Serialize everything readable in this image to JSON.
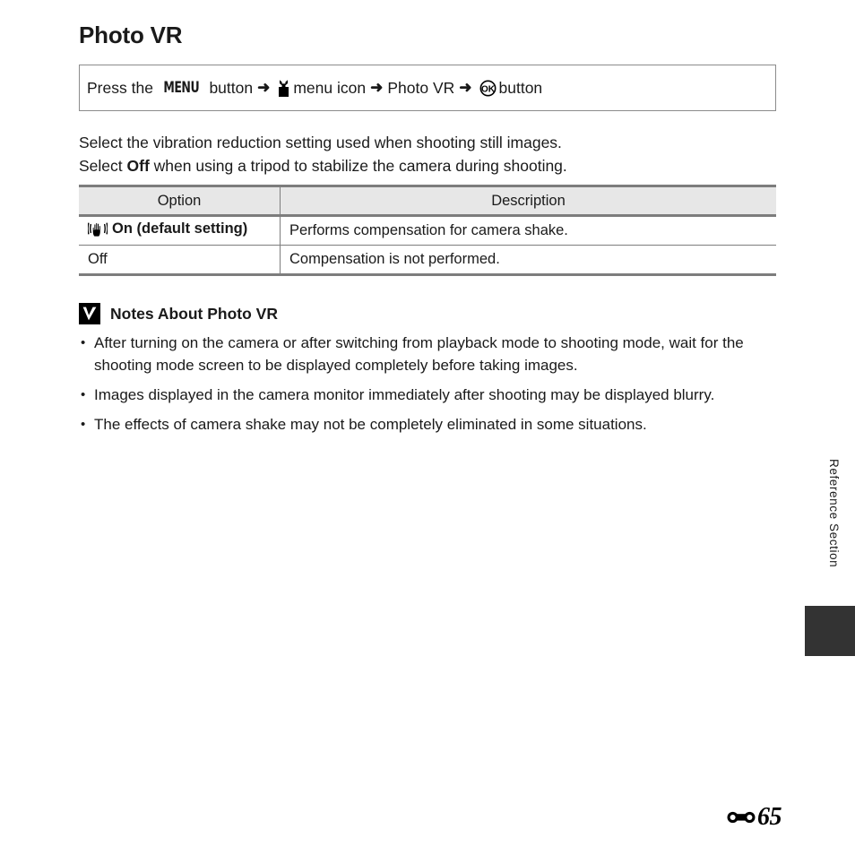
{
  "page": {
    "title": "Photo VR"
  },
  "menu_path": {
    "prefix": "Press the",
    "menu_button_glyph": "MENU",
    "after_menu_button": "button",
    "arrow": "➜",
    "setup_icon_name": "wrench-icon",
    "setup_label": "menu icon",
    "item_label": "Photo VR",
    "ok_icon_name": "ok-button-icon",
    "ok_label": "button"
  },
  "intro": {
    "line1": "Select the vibration reduction setting used when shooting still images.",
    "line2_before": "Select",
    "line2_bold": "Off",
    "line2_after": "when using a tripod to stabilize the camera during shooting."
  },
  "table": {
    "headers": [
      "Option",
      "Description"
    ],
    "rows": [
      {
        "icon": "vibration-reduction-hand-icon",
        "option": "On (default setting)",
        "description": "Performs compensation for camera shake."
      },
      {
        "icon": "",
        "option": "Off",
        "description": "Compensation is not performed."
      }
    ]
  },
  "notes": {
    "icon": "caution-check-icon",
    "heading": "Notes About Photo VR",
    "items": [
      "After turning on the camera or after switching from playback mode to shooting mode, wait for the shooting mode screen to be displayed completely before taking images.",
      "Images displayed in the camera monitor immediately after shooting may be displayed blurry.",
      "The effects of camera shake may not be completely eliminated in some situations."
    ]
  },
  "margin": {
    "section_label": "Reference Section"
  },
  "footer": {
    "ref_icon": "reference-section-icon",
    "page_number": "65"
  },
  "colors": {
    "text": "#1a1a1a",
    "rule": "#7d7d7d",
    "header_fill": "#e7e7e7",
    "tab_fill": "#333333"
  }
}
